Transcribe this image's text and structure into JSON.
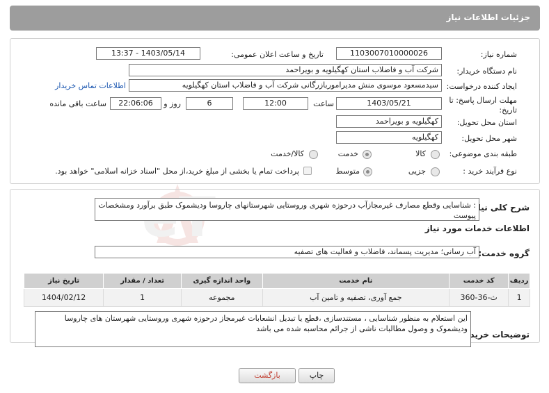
{
  "header": {
    "title": "جزئیات اطلاعات نیاز"
  },
  "form": {
    "need_number_label": "شماره نیاز:",
    "need_number": "1103007010000026",
    "announce_label": "تاریخ و ساعت اعلان عمومی:",
    "announce_value": "1403/05/14 - 13:37",
    "buyer_org_label": "نام دستگاه خریدار:",
    "buyer_org": "شرکت آب و فاضلاب استان کهگیلویه و بویراحمد",
    "creator_label": "ایجاد کننده درخواست:",
    "creator": "سیدمسعود موسوی منش مدیراموربازرگانی شرکت آب و فاضلاب استان کهگیلویه",
    "contact_link": "اطلاعات تماس خریدار",
    "deadline_label_1": "مهلت ارسال پاسخ: تا",
    "deadline_label_2": "تاریخ:",
    "deadline_date": "1403/05/21",
    "time_label": "ساعت",
    "deadline_time": "12:00",
    "days_value": "6",
    "days_label": "روز و",
    "remaining_time": "22:06:06",
    "remaining_label": "ساعت باقی مانده",
    "province_label": "استان محل تحویل:",
    "province": "کهگیلویه و بویراحمد",
    "city_label": "شهر محل تحویل:",
    "city": "کهگیلویه",
    "category_label": "طبقه بندی موضوعی:",
    "category_options": [
      "کالا",
      "خدمت",
      "کالا/خدمت"
    ],
    "category_selected": "خدمت",
    "process_label": "نوع فرآیند خرید :",
    "process_options": [
      "جزیی",
      "متوسط"
    ],
    "process_selected": "متوسط",
    "payment_note": "پرداخت تمام یا بخشی از مبلغ خرید،از محل \"اسناد خزانه اسلامی\" خواهد بود."
  },
  "summary": {
    "label": "شرح کلی نیاز:",
    "text": ": شناسایی  وقطع مصارف غیرمجازآب  درحوزه شهری وروستایی  شهرستانهای  چاروسا ودیشموک طبق برآورد ومشخصات پیوست"
  },
  "services": {
    "section_title": "اطلاعات خدمات مورد نیاز",
    "group_label": "گروه خدمت:",
    "group_value": "آب رسانی؛ مدیریت پسماند، فاضلاب و فعالیت های تصفیه",
    "columns": [
      "ردیف",
      "کد خدمت",
      "نام خدمت",
      "واحد اندازه گیری",
      "تعداد / مقدار",
      "تاریخ نیاز"
    ],
    "rows": [
      {
        "row": "1",
        "code": "ث-36-360",
        "name": "جمع آوری، تصفیه و تامین آب",
        "unit": "مجموعه",
        "qty": "1",
        "date": "1404/02/12"
      }
    ]
  },
  "buyer_notes": {
    "label": "توضیحات خریدار:",
    "text": "این استعلام به منظور شناسایی ، مستندسازی ،قطع یا تبدیل انشعابات غیرمجاز درحوزه شهری وروستایی شهرستان های چاروسا ودیشموک  و وصول مطالبات ناشی از جرائم محاسبه شده می باشد"
  },
  "buttons": {
    "print": "چاپ",
    "back": "بازگشت"
  },
  "watermark": {
    "text": "AriaTender.neT"
  },
  "colors": {
    "header_bg": "#9d9d9d",
    "link": "#1a56b0",
    "back_text": "#c0392b",
    "watermark": "#c0392b"
  }
}
